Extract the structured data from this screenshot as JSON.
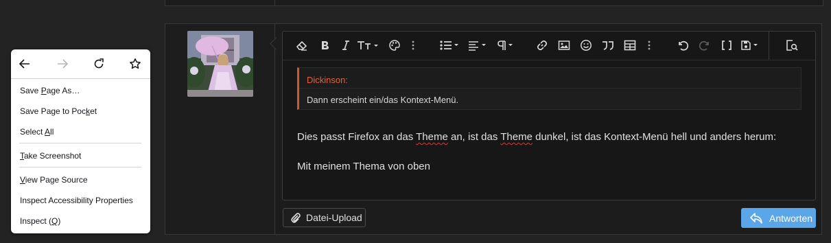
{
  "editor": {
    "quote": {
      "author": "Dickinson:",
      "text": "Dann erscheint ein/das Kontext-Menü."
    },
    "paragraph1": {
      "before": "Dies passt Firefox an das ",
      "word1": "Theme",
      "mid": " an, ist das ",
      "word2": "Theme",
      "after": " dunkel, ist das Kontext-Menü hell und anders herum:"
    },
    "paragraph2": "Mit meinem Thema von oben",
    "toolbar_icons": [
      "eraser-icon",
      "bold-icon",
      "italic-icon",
      "text-size-icon",
      "palette-icon",
      "more-vertical-icon",
      "list-icon",
      "align-icon",
      "paragraph-icon",
      "more-vertical-icon",
      "link-icon",
      "image-icon",
      "smiley-icon",
      "quote-icon",
      "table-icon",
      "more-vertical-icon",
      "undo-icon",
      "redo-icon",
      "brackets-icon",
      "save-draft-icon",
      "preview-icon"
    ]
  },
  "buttons": {
    "upload": "Datei-Upload",
    "reply": "Antworten"
  },
  "context_menu": {
    "items": [
      {
        "pre": "Save ",
        "key": "P",
        "post": "age As…"
      },
      {
        "pre": "Save Page to Poc",
        "key": "k",
        "post": "et"
      },
      {
        "pre": "Select ",
        "key": "A",
        "post": "ll"
      },
      {
        "pre": "",
        "key": "T",
        "post": "ake Screenshot"
      },
      {
        "pre": "",
        "key": "V",
        "post": "iew Page Source"
      },
      {
        "pre": "Inspect Accessibility Properties",
        "key": "",
        "post": ""
      },
      {
        "pre": "Inspect (",
        "key": "Q",
        "post": ")"
      }
    ]
  },
  "colors": {
    "background": "#232323",
    "quote_accent": "#d2562e",
    "reply_button": "#5ba6e8"
  }
}
